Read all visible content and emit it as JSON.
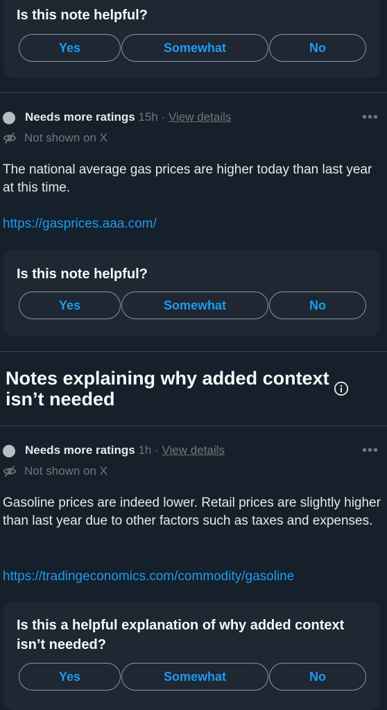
{
  "rating_prompt": {
    "title": "Is this note helpful?",
    "yes": "Yes",
    "somewhat": "Somewhat",
    "no": "No"
  },
  "note1": {
    "status": "Needs more ratings",
    "age": "15h",
    "separator": "·",
    "view_details": "View details",
    "more": "•••",
    "visibility": "Not shown on X",
    "body": "The national average gas prices are higher today than last year at this time.",
    "link": "https://gasprices.aaa.com/"
  },
  "section": {
    "title": "Notes explaining why added context isn’t needed",
    "info_icon": "info-icon"
  },
  "note2": {
    "status": "Needs more ratings",
    "age": "1h",
    "separator": "·",
    "view_details": "View details",
    "more": "•••",
    "visibility": "Not shown on X",
    "body": "Gasoline prices are indeed lower. Retail prices are slightly higher than last year due to other factors such as taxes and expenses.",
    "link": "https://tradingeconomics.com/commodity/gasoline"
  },
  "explanation_prompt": {
    "title": "Is this a helpful explanation of why added context isn’t needed?",
    "yes": "Yes",
    "somewhat": "Somewhat",
    "no": "No"
  },
  "colors": {
    "background": "#15202b",
    "card": "#1e2732",
    "accent": "#1d9bf0"
  }
}
